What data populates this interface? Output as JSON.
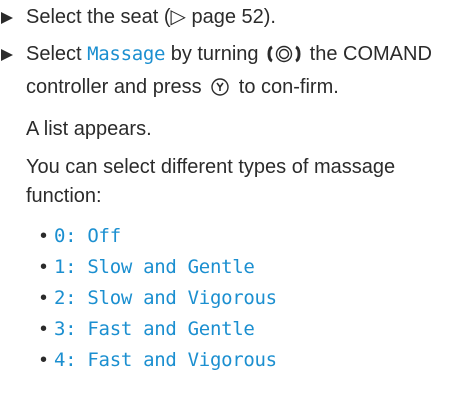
{
  "steps": [
    {
      "text_before": "Select the seat (",
      "page_ref": "▷ page 52",
      "text_after": ")."
    },
    {
      "text_select": "Select ",
      "keyword": "Massage",
      "text_by_turning": " by turning ",
      "text_the_controller": " the COMAND controller and press ",
      "text_to_confirm": " to con-firm."
    }
  ],
  "result_text": "A list appears.",
  "intro_text": "You can select different types of massage function:",
  "options": [
    "0: Off",
    "1: Slow and Gentle",
    "2: Slow and Vigorous",
    "3: Fast and Gentle",
    "4: Fast and Vigorous"
  ],
  "colors": {
    "keyword": "#1b8fd0",
    "text": "#2b2b2b"
  },
  "icons": {
    "step_marker": "triangle-arrow-icon",
    "turn": "controller-turn-icon",
    "press": "controller-press-icon"
  }
}
